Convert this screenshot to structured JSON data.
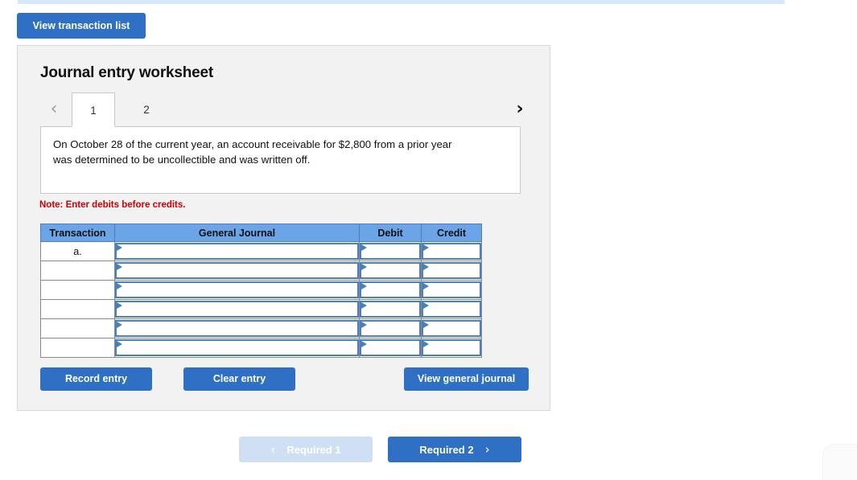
{
  "top_strip": {
    "color": "#d6e9fa"
  },
  "toolbar": {
    "view_transaction_list_label": "View transaction list"
  },
  "worksheet": {
    "title": "Journal entry worksheet",
    "tabs": [
      {
        "label": "1",
        "active": true
      },
      {
        "label": "2",
        "active": false
      }
    ],
    "prev_icon": "‹",
    "next_icon": "›",
    "description": "On October 28 of the current year, an account receivable for $2,800 from a prior year was determined to be uncollectible and was written off.",
    "note": "Note: Enter debits before credits.",
    "note_color": "#cc0000",
    "table": {
      "headers": [
        "Transaction",
        "General Journal",
        "Debit",
        "Credit"
      ],
      "rows": [
        {
          "transaction": "a.",
          "general_journal": "",
          "debit": "",
          "credit": ""
        },
        {
          "transaction": "",
          "general_journal": "",
          "debit": "",
          "credit": ""
        },
        {
          "transaction": "",
          "general_journal": "",
          "debit": "",
          "credit": ""
        },
        {
          "transaction": "",
          "general_journal": "",
          "debit": "",
          "credit": ""
        },
        {
          "transaction": "",
          "general_journal": "",
          "debit": "",
          "credit": ""
        },
        {
          "transaction": "",
          "general_journal": "",
          "debit": "",
          "credit": ""
        }
      ],
      "header_color": "#6ca4e8",
      "input_border_color": "#4a7fbd"
    },
    "actions": {
      "record_entry_label": "Record entry",
      "clear_entry_label": "Clear entry",
      "view_general_journal_label": "View general journal"
    }
  },
  "footer_nav": {
    "prev": {
      "label": "Required 1",
      "icon": "‹",
      "enabled": false,
      "color": "#cfe0f5"
    },
    "next": {
      "label": "Required 2",
      "icon": "›",
      "enabled": true,
      "color": "#2f6fc4"
    }
  }
}
